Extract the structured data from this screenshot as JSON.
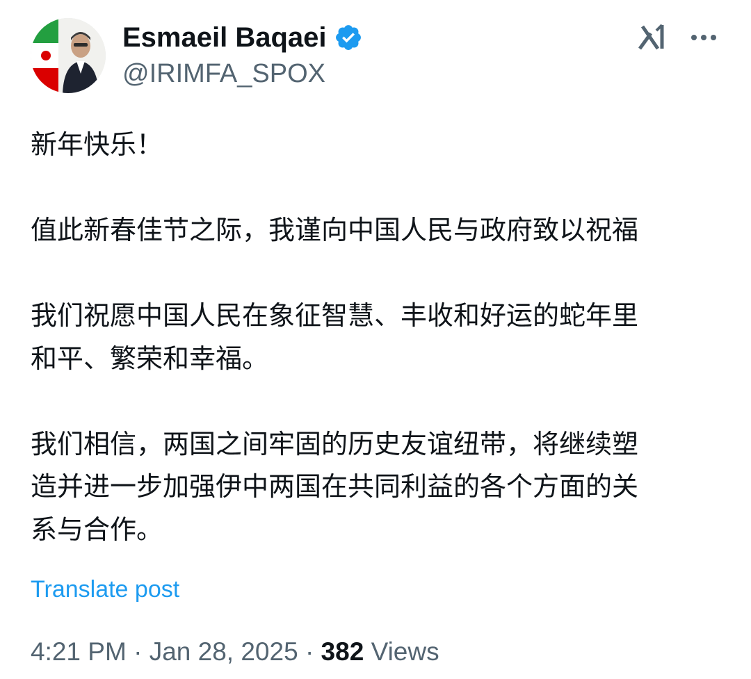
{
  "author": {
    "display_name": "Esmaeil Baqaei",
    "handle": "@IRIMFA_SPOX",
    "verified": true
  },
  "icons": {
    "verified": "verified-badge-icon",
    "grok": "grok-icon",
    "more": "more-options-icon"
  },
  "colors": {
    "verified_blue": "#1d9bf0",
    "link_blue": "#1d9bf0",
    "text_primary": "#0f1419",
    "text_secondary": "#536471"
  },
  "post": {
    "paragraphs": [
      "新年快乐！",
      "值此新春佳节之际，我谨向中国人民与政府致以祝福",
      "我们祝愿中国人民在象征智慧、丰收和好运的蛇年里\n和平、繁荣和幸福。",
      "我们相信，两国之间牢固的历史友谊纽带，将继续塑\n造并进一步加强伊中两国在共同利益的各个方面的关\n系与合作。"
    ],
    "translate_label": "Translate post",
    "time": "4:21 PM",
    "date": "Jan 28, 2025",
    "separator": "·",
    "views_count": "382",
    "views_label": "Views"
  }
}
